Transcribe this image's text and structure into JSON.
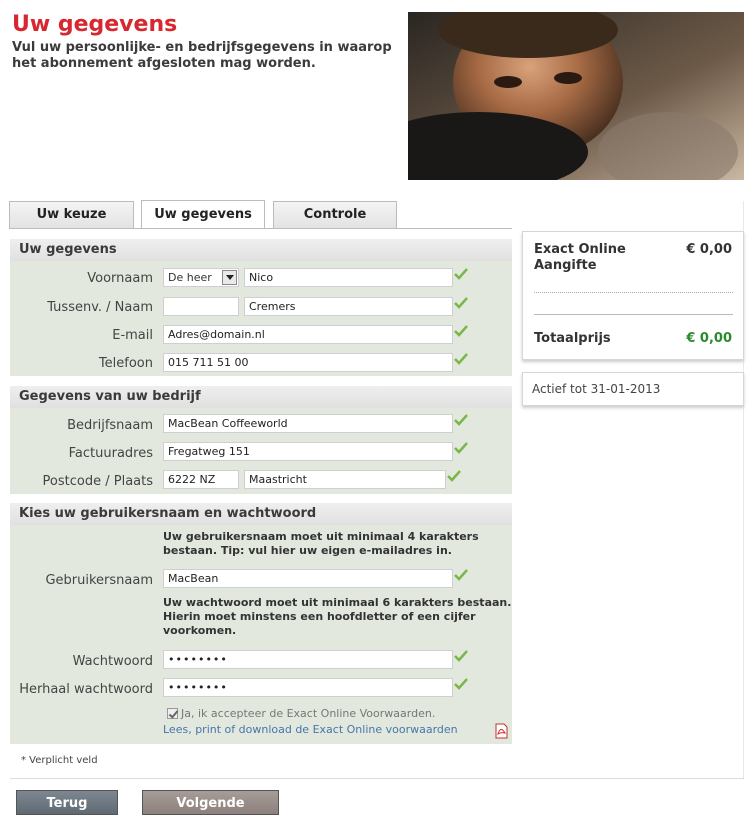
{
  "header": {
    "title": "Uw gegevens",
    "subtitle": "Vul uw persoonlijke- en bedrijfsgegevens in waarop het abonnement afgesloten mag worden."
  },
  "tabs": [
    {
      "label": "Uw keuze",
      "active": false
    },
    {
      "label": "Uw gegevens",
      "active": true
    },
    {
      "label": "Controle",
      "active": false
    }
  ],
  "personal": {
    "heading": "Uw gegevens",
    "voornaam_label": "Voornaam",
    "salutation": "De heer",
    "voornaam": "Nico",
    "tussenv_label": "Tussenv. / Naam",
    "tussenv": "",
    "naam": "Cremers",
    "email_label": "E-mail",
    "email": "Adres@domain.nl",
    "telefoon_label": "Telefoon",
    "telefoon": "015 711 51 00"
  },
  "company": {
    "heading": "Gegevens van uw bedrijf",
    "bedrijfsnaam_label": "Bedrijfsnaam",
    "bedrijfsnaam": "MacBean Coffeeworld",
    "factuuradres_label": "Factuuradres",
    "factuuradres": "Fregatweg 151",
    "postcode_label": "Postcode / Plaats",
    "postcode": "6222 NZ",
    "plaats": "Maastricht"
  },
  "account": {
    "heading": "Kies uw gebruikersnaam en wachtwoord",
    "username_hint": "Uw gebruikersnaam moet uit minimaal 4 karakters bestaan. Tip: vul hier uw eigen e-mailadres in.",
    "username_label": "Gebruikersnaam",
    "username": "MacBean",
    "password_hint": "Uw wachtwoord moet uit minimaal 6 karakters bestaan. Hierin moet minstens een hoofdletter of een cijfer voorkomen.",
    "password_label": "Wachtwoord",
    "password": "••••••••",
    "password_repeat_label": "Herhaal wachtwoord",
    "password_repeat": "••••••••",
    "agree_label": "Ja, ik accepteer de Exact Online Voorwaarden.",
    "terms_link": "Lees, print of download de Exact Online voorwaarden"
  },
  "required_note": "* Verplicht veld",
  "buttons": {
    "back": "Terug",
    "next": "Volgende"
  },
  "summary": {
    "product": "Exact Online Aangifte",
    "product_price": "€ 0,00",
    "total_label": "Totaalprijs",
    "total_value": "€ 0,00",
    "active_until": "Actief tot 31-01-2013"
  },
  "colors": {
    "title": "#d7282f",
    "form_bg": "#e3e8de",
    "check": "#7ab648",
    "total": "#2b8a2b"
  }
}
